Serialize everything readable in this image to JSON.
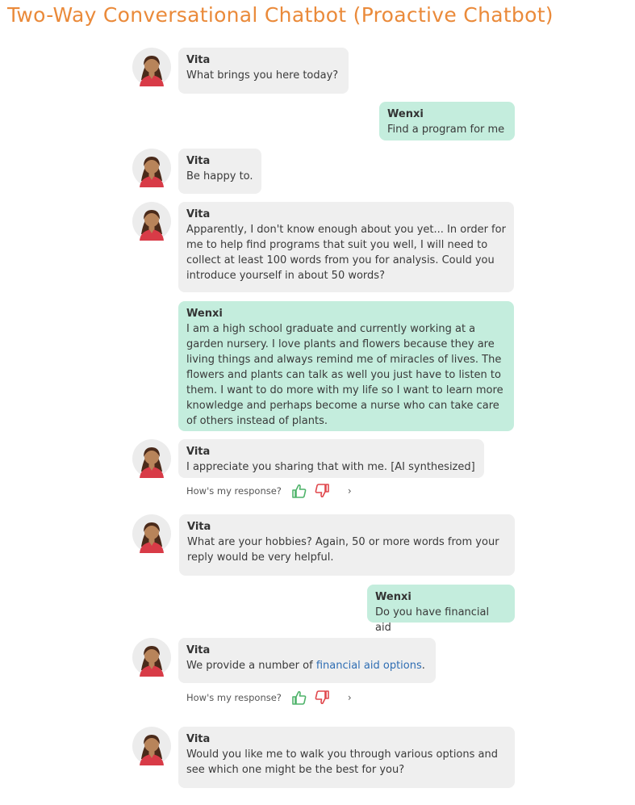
{
  "title": "Two-Way Conversational Chatbot (Proactive Chatbot)",
  "feedback": {
    "prompt": "How's my response?",
    "more": "›"
  },
  "colors": {
    "title": "#ea8a3a",
    "bot_bubble": "#efefef",
    "user_bubble": "#c4eddd",
    "link": "#2e6db3",
    "thumbs_up": "#4fb36a",
    "thumbs_down": "#e0474c"
  },
  "messages": [
    {
      "sender": "Vita",
      "role": "bot",
      "text": "What brings you here today?"
    },
    {
      "sender": "Wenxi",
      "role": "user",
      "text": "Find a program for me"
    },
    {
      "sender": "Vita",
      "role": "bot",
      "text": "Be happy to."
    },
    {
      "sender": "Vita",
      "role": "bot",
      "text": "Apparently, I don't know enough about you yet... In order for me to help find programs that suit you well, I will need to collect at least 100 words from you for analysis. Could you introduce yourself in about 50 words?"
    },
    {
      "sender": "Wenxi",
      "role": "user",
      "text": "I am a high school graduate and currently working at a garden nursery. I love plants and flowers because they are living things and always remind me of miracles of lives. The flowers and plants can talk as well you just have to listen to them. I want to do more with my life so I want to learn more knowledge and perhaps become a nurse who can take care of others instead of plants."
    },
    {
      "sender": "Vita",
      "role": "bot",
      "text": "I appreciate you sharing that with me. [AI synthesized]"
    },
    {
      "sender": "Vita",
      "role": "bot",
      "text": "What are your hobbies? Again, 50 or more words from your reply would be very helpful."
    },
    {
      "sender": "Wenxi",
      "role": "user",
      "text": "Do you have financial aid"
    },
    {
      "sender": "Vita",
      "role": "bot",
      "text_before": "We provide a number of ",
      "link": "financial aid options",
      "text_after": "."
    },
    {
      "sender": "Vita",
      "role": "bot",
      "text": "Would you like me to walk you through various options and see which one might be the best for you?"
    }
  ]
}
